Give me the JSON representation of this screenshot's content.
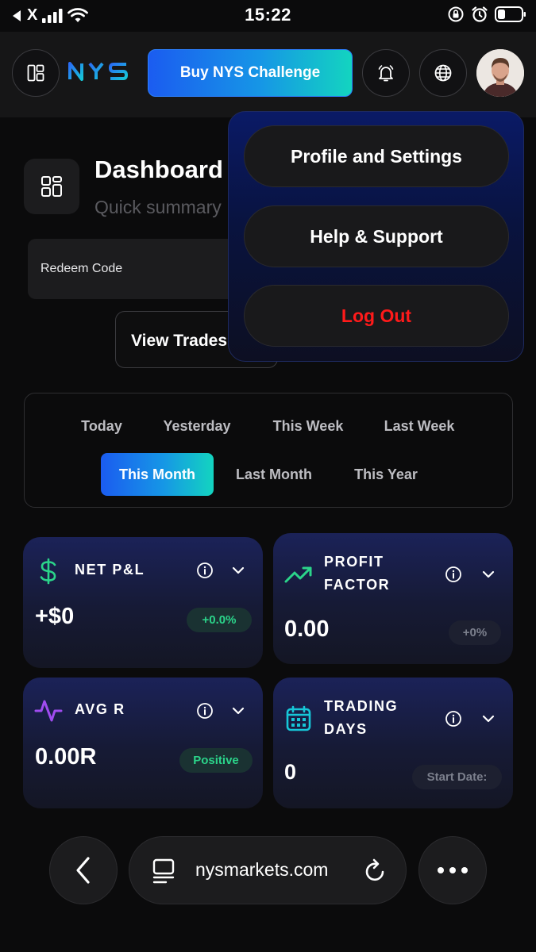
{
  "status_bar": {
    "back_app": "X",
    "time": "15:22"
  },
  "header": {
    "brand": "NYS",
    "buy_button": "Buy NYS Challenge",
    "brand_color": "#1f8df0"
  },
  "page": {
    "title": "Dashboard",
    "subtitle": "Quick summary",
    "redeem_label": "Redeem Code",
    "view_trades_label": "View Trades"
  },
  "profile_menu": {
    "items": [
      {
        "label": "Profile and Settings"
      },
      {
        "label": "Help & Support"
      },
      {
        "label": "Log Out",
        "color": "#ff1a1a"
      }
    ]
  },
  "period_filter": {
    "options": [
      "Today",
      "Yesterday",
      "This Week",
      "Last Week",
      "This Month",
      "Last Month",
      "This Year"
    ],
    "selected": "This Month"
  },
  "stats": {
    "net_pnl": {
      "title": "NET P&L",
      "value": "+$0",
      "badge": "+0.0%"
    },
    "profit_factor": {
      "title_line1": "PROFIT",
      "title_line2": "FACTOR",
      "value": "0.00",
      "badge": "+0%"
    },
    "avg_r": {
      "title": "AVG R",
      "value": "0.00R",
      "badge": "Positive"
    },
    "trading_days": {
      "title_line1": "TRADING",
      "title_line2": "DAYS",
      "value": "0",
      "badge": "Start Date:"
    }
  },
  "browser": {
    "url": "nysmarkets.com"
  },
  "colors": {
    "accent_gradient_start": "#1b5cf0",
    "accent_gradient_end": "#13d4c0",
    "positive": "#2bd48a",
    "danger": "#ff1a1a",
    "card_bg": "#1b2258"
  }
}
